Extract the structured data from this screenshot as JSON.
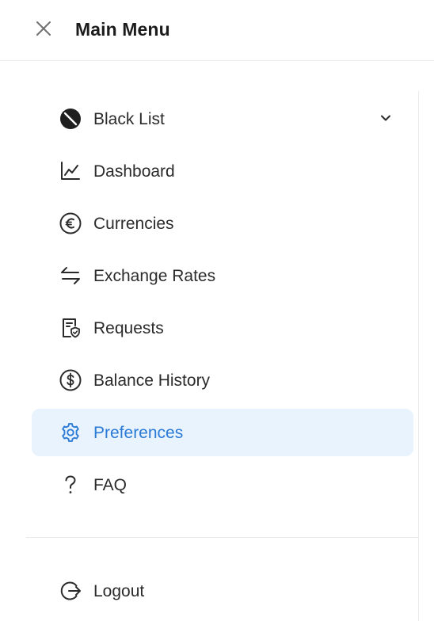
{
  "header": {
    "title": "Main Menu",
    "close_icon": "close-icon"
  },
  "menu": {
    "items": [
      {
        "label": "Black List",
        "icon": "block-icon",
        "expandable": true
      },
      {
        "label": "Dashboard",
        "icon": "line-chart-icon"
      },
      {
        "label": "Currencies",
        "icon": "euro-icon"
      },
      {
        "label": "Exchange Rates",
        "icon": "exchange-arrows-icon"
      },
      {
        "label": "Requests",
        "icon": "document-shield-icon"
      },
      {
        "label": "Balance History",
        "icon": "dollar-circle-icon"
      },
      {
        "label": "Preferences",
        "icon": "gear-icon",
        "active": true
      },
      {
        "label": "FAQ",
        "icon": "question-icon"
      }
    ]
  },
  "footer": {
    "logout_label": "Logout",
    "logout_icon": "logout-icon"
  },
  "colors": {
    "active_background": "#e8f3fd",
    "active_accent": "#2a7ad6",
    "text": "#2b2b2b"
  }
}
